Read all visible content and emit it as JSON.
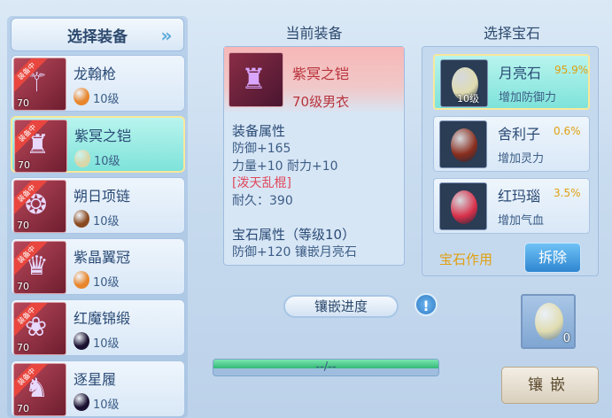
{
  "left": {
    "title": "选择装备",
    "items": [
      {
        "name": "龙翰枪",
        "badge": "装备中",
        "level": "70",
        "gem_level": "10级",
        "gem_color": "#e8862c",
        "glyph": "⚚",
        "selected": false
      },
      {
        "name": "紫冥之铠",
        "badge": "装备中",
        "level": "70",
        "gem_level": "10级",
        "gem_color": "#d9d6a8",
        "glyph": "♜",
        "selected": true
      },
      {
        "name": "朔日项链",
        "badge": "装备中",
        "level": "70",
        "gem_level": "10级",
        "gem_color": "#8a4a20",
        "glyph": "❂",
        "selected": false
      },
      {
        "name": "紫晶翼冠",
        "badge": "装备中",
        "level": "70",
        "gem_level": "10级",
        "gem_color": "#e8862c",
        "glyph": "♛",
        "selected": false
      },
      {
        "name": "红魔锦缎",
        "badge": "装备中",
        "level": "70",
        "gem_level": "10级",
        "gem_color": "#1a1030",
        "glyph": "❀",
        "selected": false
      },
      {
        "name": "逐星履",
        "badge": "装备中",
        "level": "70",
        "gem_level": "10级",
        "gem_color": "#1a1030",
        "glyph": "♞",
        "selected": false
      }
    ]
  },
  "middle": {
    "header": "当前装备",
    "name": "紫冥之铠",
    "desc": "70级男衣",
    "attr_head": "装备属性",
    "attrs": [
      "防御+165",
      "力量+10 耐力+10"
    ],
    "special": "[泼天乱棍]",
    "durability": "耐久：390",
    "gem_head": "宝石属性（等级10）",
    "gem_attr": "防御+120 镶嵌月亮石",
    "progress_label": "镶嵌进度",
    "info_icon": "!",
    "progress_text": "--/--",
    "progress_value": 1.0
  },
  "right": {
    "header": "选择宝石",
    "gems": [
      {
        "name": "月亮石",
        "pct": "95.9%",
        "effect": "增加防御力",
        "level": "10级",
        "color": "#e0dcb0",
        "selected": true
      },
      {
        "name": "舍利子",
        "pct": "0.6%",
        "effect": "增加灵力",
        "level": "",
        "color": "#8a2e1e",
        "selected": false
      },
      {
        "name": "红玛瑙",
        "pct": "3.5%",
        "effect": "增加气血",
        "level": "",
        "color": "#d8304a",
        "selected": false
      }
    ],
    "effect_label": "宝石作用",
    "dismantle": "拆除",
    "slot_count": "0",
    "slot_color": "#e0dcb0",
    "inlay": "镶嵌"
  }
}
